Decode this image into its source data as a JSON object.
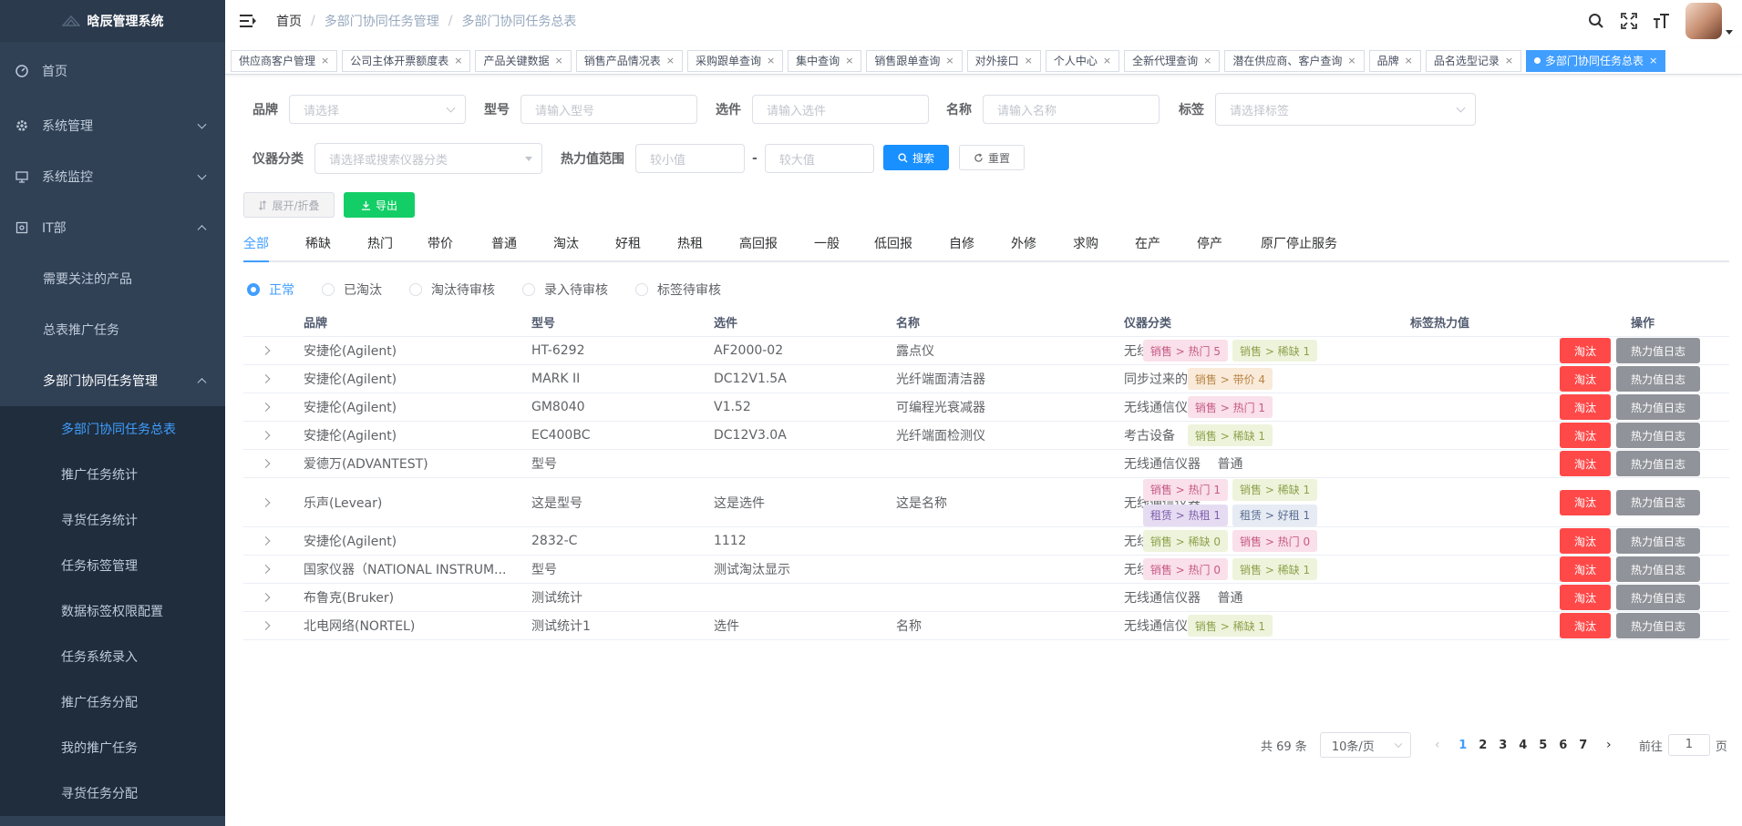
{
  "app": {
    "title": "晗辰管理系统"
  },
  "sidebar": {
    "items": [
      {
        "label": "首页",
        "icon": "dashboard-icon"
      },
      {
        "label": "系统管理",
        "icon": "gear-icon"
      },
      {
        "label": "系统监控",
        "icon": "monitor-icon"
      },
      {
        "label": "IT部",
        "icon": "server-icon"
      }
    ],
    "sub_items": [
      {
        "label": "需要关注的产品"
      },
      {
        "label": "总表推广任务"
      },
      {
        "label": "多部门协同任务管理"
      }
    ],
    "nested_items": [
      {
        "label": "多部门协同任务总表",
        "active": true
      },
      {
        "label": "推广任务统计"
      },
      {
        "label": "寻货任务统计"
      },
      {
        "label": "任务标签管理"
      },
      {
        "label": "数据标签权限配置"
      },
      {
        "label": "任务系统录入"
      },
      {
        "label": "推广任务分配"
      },
      {
        "label": "我的推广任务"
      },
      {
        "label": "寻货任务分配"
      }
    ]
  },
  "breadcrumb": [
    "首页",
    "多部门协同任务管理",
    "多部门协同任务总表"
  ],
  "tags": [
    "供应商客户管理",
    "公司主体开票额度表",
    "产品关键数据",
    "销售产品情况表",
    "采购跟单查询",
    "集中查询",
    "销售跟单查询",
    "对外接口",
    "个人中心",
    "全新代理查询",
    "潜在供应商、客户查询",
    "品牌",
    "品名选型记录",
    "多部门协同任务总表"
  ],
  "filters": {
    "brand_label": "品牌",
    "brand_placeholder": "请选择",
    "model_label": "型号",
    "model_placeholder": "请输入型号",
    "option_label": "选件",
    "option_placeholder": "请输入选件",
    "name_label": "名称",
    "name_placeholder": "请输入名称",
    "tag_label": "标签",
    "tag_placeholder": "请选择标签",
    "category_label": "仪器分类",
    "category_placeholder": "请选择或搜索仪器分类",
    "heat_label": "热力值范围",
    "heat_min_placeholder": "较小值",
    "heat_range_sep": "-",
    "heat_max_placeholder": "较大值",
    "search_button": "搜索",
    "reset_button": "重置"
  },
  "toolbar": {
    "expand_button": "展开/折叠",
    "export_button": "导出"
  },
  "category_tabs": [
    "全部",
    "稀缺",
    "热门",
    "带价",
    "普通",
    "淘汰",
    "好租",
    "热租",
    "高回报",
    "一般",
    "低回报",
    "自修",
    "外修",
    "求购",
    "在产",
    "停产",
    "原厂停止服务"
  ],
  "status_radios": [
    {
      "label": "正常",
      "checked": true
    },
    {
      "label": "已淘汰"
    },
    {
      "label": "淘汰待审核"
    },
    {
      "label": "录入待审核"
    },
    {
      "label": "标签待审核"
    }
  ],
  "table": {
    "columns": [
      "品牌",
      "型号",
      "选件",
      "名称",
      "仪器分类",
      "标签热力值",
      "操作"
    ],
    "action_eliminate": "淘汰",
    "action_log": "热力值日志",
    "rows": [
      {
        "brand": "安捷伦(Agilent)",
        "model": "HT-6292",
        "option": "AF2000-02",
        "name": "露点仪",
        "category": "无线通信仪器",
        "tags": [
          {
            "t": "销售 > 热门 5",
            "c": "pink"
          },
          {
            "t": "销售 > 稀缺 1",
            "c": "green"
          }
        ]
      },
      {
        "brand": "安捷伦(Agilent)",
        "model": "MARK II",
        "option": "DC12V1.5A",
        "name": "光纤端面清洁器",
        "category": "同步过来的1",
        "tags": [
          {
            "t": "销售 > 带价 4",
            "c": "orange"
          }
        ]
      },
      {
        "brand": "安捷伦(Agilent)",
        "model": "GM8040",
        "option": "V1.52",
        "name": "可编程光衰减器",
        "category": "无线通信仪器",
        "tags": [
          {
            "t": "销售 > 热门 1",
            "c": "pink"
          }
        ]
      },
      {
        "brand": "安捷伦(Agilent)",
        "model": "EC400BC",
        "option": "DC12V3.0A",
        "name": "光纤端面检测仪",
        "category": "考古设备",
        "tags": [
          {
            "t": "销售 > 稀缺 1",
            "c": "green"
          }
        ]
      },
      {
        "brand": "爱德万(ADVANTEST)",
        "model": "型号",
        "option": "",
        "name": "",
        "category": "无线通信仪器",
        "plain": "普通",
        "tags": []
      },
      {
        "brand": "乐声(Levear)",
        "model": "这是型号",
        "option": "这是选件",
        "name": "这是名称",
        "category": "无线通信仪器",
        "tags": [
          {
            "t": "销售 > 热门 1",
            "c": "pink"
          },
          {
            "t": "销售 > 稀缺 1",
            "c": "green"
          },
          {
            "t": "租赁 > 热租 1",
            "c": "purple"
          },
          {
            "t": "租赁 > 好租 1",
            "c": "blue"
          }
        ]
      },
      {
        "brand": "安捷伦(Agilent)",
        "model": "2832-C",
        "option": "1112",
        "name": "",
        "category": "无线通信仪器",
        "tags": [
          {
            "t": "销售 > 稀缺 0",
            "c": "green"
          },
          {
            "t": "销售 > 热门 0",
            "c": "pink"
          }
        ]
      },
      {
        "brand": "国家仪器（NATIONAL INSTRUM...",
        "model": "型号",
        "option": "测试淘汰显示",
        "name": "",
        "category": "无线通信仪器",
        "tags": [
          {
            "t": "销售 > 热门 0",
            "c": "pink"
          },
          {
            "t": "销售 > 稀缺 1",
            "c": "green"
          }
        ]
      },
      {
        "brand": "布鲁克(Bruker)",
        "model": "测试统计",
        "option": "",
        "name": "",
        "category": "无线通信仪器",
        "plain": "普通",
        "tags": []
      },
      {
        "brand": "北电网络(NORTEL)",
        "model": "测试统计1",
        "option": "选件",
        "name": "名称",
        "category": "无线通信仪器",
        "tags": [
          {
            "t": "销售 > 稀缺 1",
            "c": "green"
          }
        ]
      }
    ]
  },
  "pagination": {
    "total": "共 69 条",
    "page_size": "10条/页",
    "pages": [
      "1",
      "2",
      "3",
      "4",
      "5",
      "6",
      "7"
    ],
    "current": "1",
    "prev_arrow": "‹",
    "next_arrow": "›",
    "jump_label": "前往",
    "jump_value": "1",
    "jump_suffix": "页"
  },
  "tag_colors": {
    "pink": [
      "#f9e0ea",
      "#c85a85"
    ],
    "green": [
      "#eef3dc",
      "#8da24b"
    ],
    "orange": [
      "#f9ead9",
      "#b98546"
    ],
    "purple": [
      "#e6dcf2",
      "#8060ad"
    ],
    "blue": [
      "#e6ebf4",
      "#5c6f92"
    ]
  },
  "colors": {
    "accent": "#409eff",
    "sidebar_bg": "#304156",
    "danger": "#ff4949",
    "success": "#13ce66"
  }
}
